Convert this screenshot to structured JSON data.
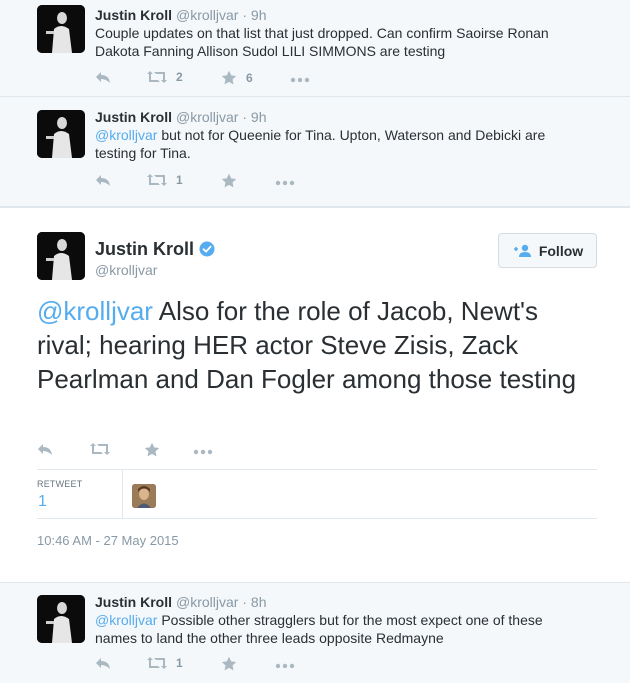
{
  "colors": {
    "link": "#55acee",
    "muted": "#8899a6",
    "text": "#292f33",
    "verified": "#55acee"
  },
  "tweets": [
    {
      "name": "Justin Kroll",
      "handle": "@krolljvar",
      "separator": "·",
      "time": "9h",
      "text": "Couple updates on that list that just dropped. Can confirm Saoirse Ronan Dakota Fanning Allison Sudol LILI SIMMONS are testing",
      "retweets": "2",
      "favorites": "6"
    },
    {
      "name": "Justin Kroll",
      "handle": "@krolljvar",
      "separator": "·",
      "time": "9h",
      "mention": "@krolljvar",
      "text": " but not for Queenie for Tina. Upton, Waterson and Debicki are testing for Tina.",
      "retweets": "1"
    },
    {
      "name": "Justin Kroll",
      "handle": "@krolljvar",
      "separator": "·",
      "time": "8h",
      "mention": "@krolljvar",
      "text": " Possible other stragglers but for the most expect one of these names to land the other three leads opposite Redmayne",
      "retweets": "1"
    }
  ],
  "main_tweet": {
    "name": "Justin Kroll",
    "handle": "@krolljvar",
    "follow_label": "Follow",
    "mention": "@krolljvar",
    "text": " Also for the role of Jacob, Newt's rival; hearing HER actor Steve Zisis, Zack Pearlman and Dan Fogler among those testing",
    "retweet_label": "RETWEET",
    "retweet_count": "1",
    "timestamp": "10:46 AM - 27 May 2015"
  },
  "icons": [
    "reply-icon",
    "retweet-icon",
    "favorite-icon",
    "more-icon",
    "verified-icon",
    "follow-user-icon"
  ]
}
